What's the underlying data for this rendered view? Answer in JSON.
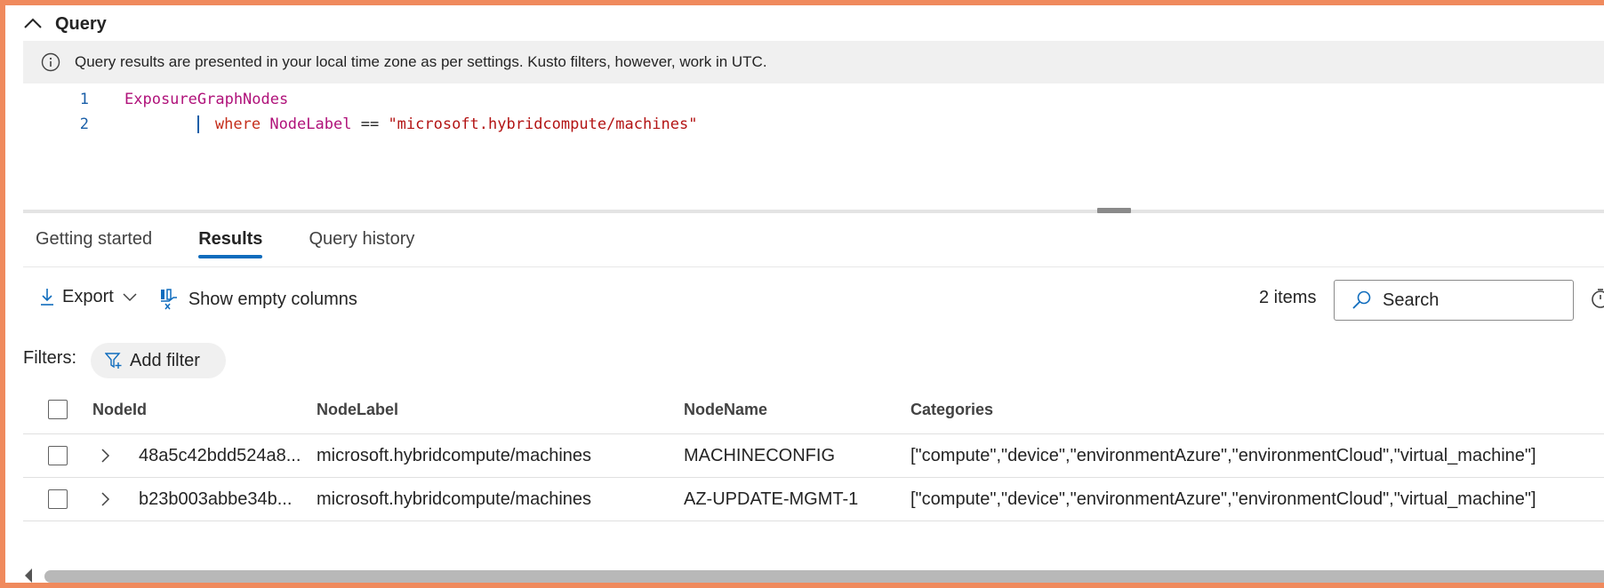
{
  "query": {
    "title": "Query",
    "info_text": "Query results are presented in your local time zone as per settings. Kusto filters, however, work in UTC.",
    "lines": [
      {
        "number": "1",
        "table": "ExposureGraphNodes"
      },
      {
        "number": "2",
        "keyword": "where",
        "field": "NodeLabel",
        "operator": "==",
        "value": "\"microsoft.hybridcompute/machines\""
      }
    ]
  },
  "tabs": [
    {
      "label": "Getting started",
      "active": false
    },
    {
      "label": "Results",
      "active": true
    },
    {
      "label": "Query history",
      "active": false
    }
  ],
  "toolbar": {
    "export_label": "Export",
    "show_empty_label": "Show empty columns",
    "items_count": "2 items",
    "search_placeholder": "Search"
  },
  "filters": {
    "label": "Filters:",
    "add_filter_label": "Add filter"
  },
  "table": {
    "columns": [
      "NodeId",
      "NodeLabel",
      "NodeName",
      "Categories"
    ],
    "rows": [
      {
        "node_id": "48a5c42bdd524a8...",
        "node_label": "microsoft.hybridcompute/machines",
        "node_name": "MACHINECONFIG",
        "categories": "[\"compute\",\"device\",\"environmentAzure\",\"environmentCloud\",\"virtual_machine\"]"
      },
      {
        "node_id": "b23b003abbe34b...",
        "node_label": "microsoft.hybridcompute/machines",
        "node_name": "AZ-UPDATE-MGMT-1",
        "categories": "[\"compute\",\"device\",\"environmentAzure\",\"environmentCloud\",\"virtual_machine\"]"
      }
    ]
  },
  "colors": {
    "frame_border": "#f08a5d",
    "accent": "#0f6cbd",
    "info_bar": "#f0f0f0"
  }
}
